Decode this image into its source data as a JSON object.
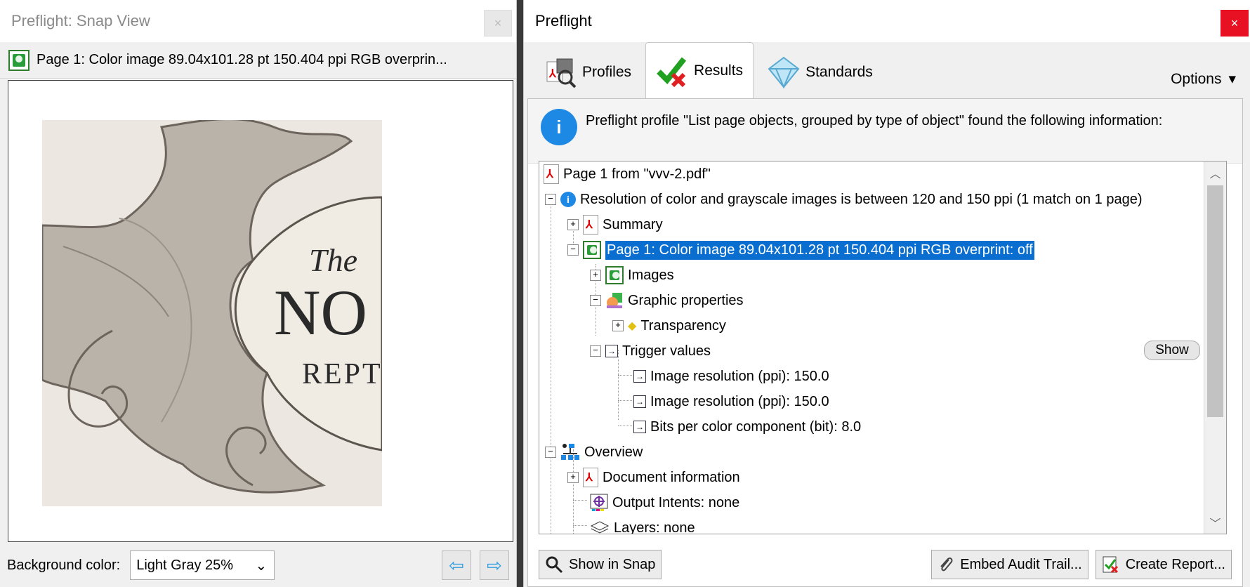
{
  "snap_window": {
    "title": "Preflight: Snap View",
    "close_label": "×",
    "header_text": "Page 1: Color image 89.04x101.28 pt 150.404 ppi RGB overprin...",
    "preview_text": {
      "line1": "The",
      "line2": "NO",
      "line3": "REPT"
    },
    "background_label": "Background color:",
    "background_value": "Light Gray 25%",
    "prev_label": "⇦",
    "next_label": "⇨"
  },
  "preflight_window": {
    "title": "Preflight",
    "close_label": "×",
    "tabs": [
      {
        "label": "Profiles",
        "icon": "profiles-icon"
      },
      {
        "label": "Results",
        "icon": "results-icon",
        "active": true
      },
      {
        "label": "Standards",
        "icon": "standards-icon"
      }
    ],
    "options_label": "Options",
    "info_text": "Preflight profile \"List page objects, grouped by type of object\" found the following information:",
    "tree": {
      "root": "Page 1 from \"vvv-2.pdf\"",
      "resolution": "Resolution of color and grayscale images is between 120 and 150 ppi (1 match on 1 page)",
      "summary": "Summary",
      "page_image": "Page 1: Color image 89.04x101.28 pt 150.404 ppi RGB  overprint: off",
      "images": "Images",
      "graphic_properties": "Graphic properties",
      "transparency": "Transparency",
      "trigger_values": "Trigger values",
      "trigger1": "Image resolution (ppi): 150.0",
      "trigger2": "Image resolution (ppi): 150.0",
      "trigger3": "Bits per color component (bit): 8.0",
      "overview": "Overview",
      "doc_info": "Document information",
      "output_intents": "Output Intents: none",
      "layers": "Layers: none"
    },
    "show_label": "Show",
    "show_in_snap": "Show in Snap",
    "embed_audit": "Embed Audit Trail...",
    "create_report": "Create Report..."
  }
}
